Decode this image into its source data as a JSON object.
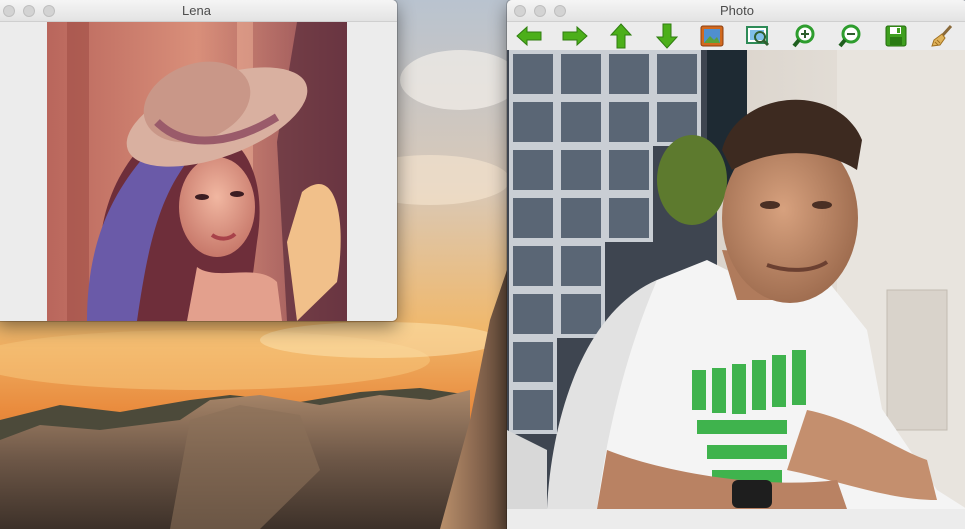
{
  "windows": {
    "lena": {
      "title": "Lena"
    },
    "photo": {
      "title": "Photo"
    }
  },
  "toolbar": {
    "buttons": [
      {
        "icon": "arrow-left-icon",
        "color": "#4caf1a"
      },
      {
        "icon": "arrow-right-icon",
        "color": "#4caf1a"
      },
      {
        "icon": "arrow-up-icon",
        "color": "#4caf1a"
      },
      {
        "icon": "arrow-down-icon",
        "color": "#4caf1a"
      },
      {
        "icon": "image-icon",
        "color": "#d2691e"
      },
      {
        "icon": "fit-to-window-icon",
        "color": "#2e8b57"
      },
      {
        "icon": "zoom-in-icon",
        "color": "#2e9d2e"
      },
      {
        "icon": "zoom-out-icon",
        "color": "#2e9d2e"
      },
      {
        "icon": "save-icon",
        "color": "#3f9f1f"
      },
      {
        "icon": "clear-brush-icon",
        "color": "#c8902a"
      }
    ]
  },
  "colors": {
    "icon_green": "#4caf1a",
    "window_bg": "#ececec"
  }
}
